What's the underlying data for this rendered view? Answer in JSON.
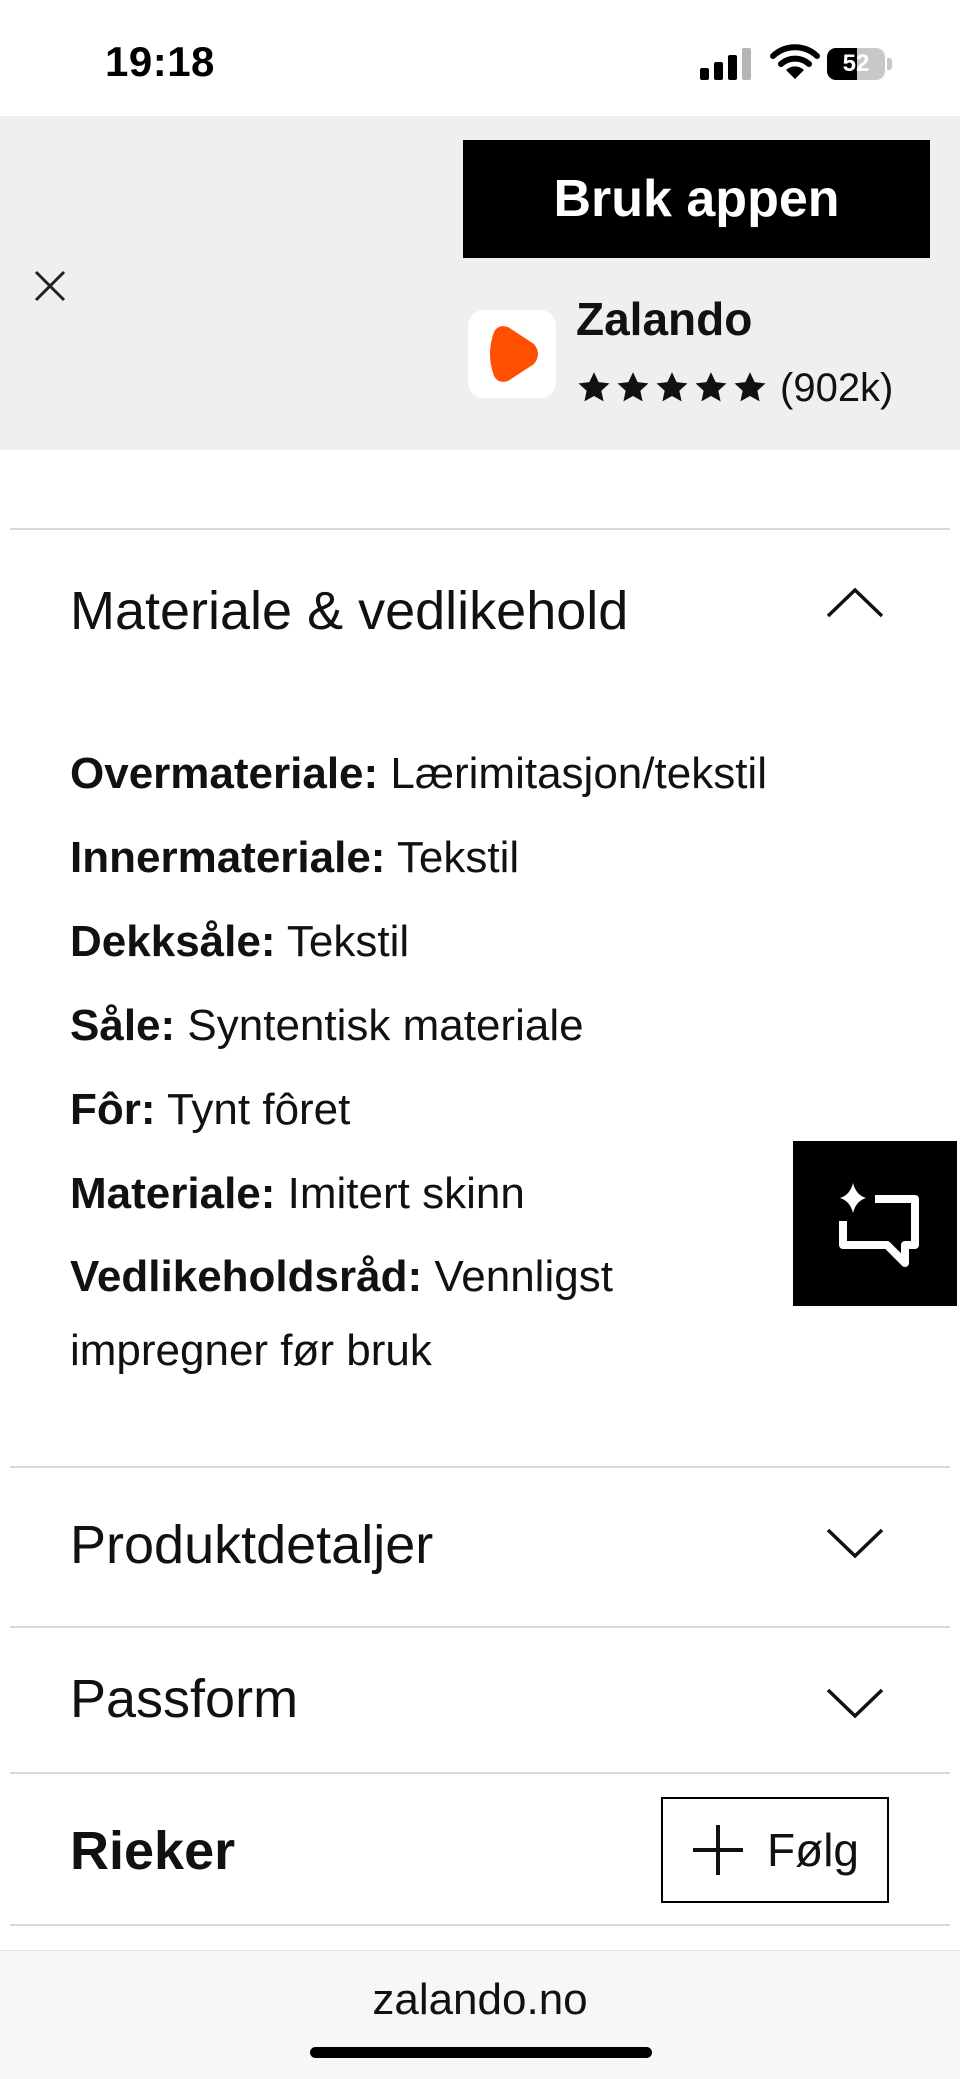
{
  "status_bar": {
    "time": "19:18",
    "battery": "52",
    "battery_level": 0.52
  },
  "banner": {
    "cta_label": "Bruk appen",
    "app_name": "Zalando",
    "rating_stars": 5,
    "rating_count": "(902k)",
    "icon": "zalando-logo",
    "accent_color": "#ff4f00"
  },
  "sections": {
    "material": {
      "title": "Materiale & vedlikehold",
      "expanded": true,
      "items": [
        {
          "label": "Overmateriale:",
          "value": "Lærimitasjon/tekstil"
        },
        {
          "label": "Innermateriale:",
          "value": "Tekstil"
        },
        {
          "label": "Dekksåle:",
          "value": "Tekstil"
        },
        {
          "label": "Såle:",
          "value": "Syntentisk materiale"
        },
        {
          "label": "Fôr:",
          "value": "Tynt fôret"
        },
        {
          "label": "Materiale:",
          "value": "Imitert skinn"
        },
        {
          "label": "Vedlikeholdsråd:",
          "value": "Vennligst impregner før bruk"
        }
      ]
    },
    "product_details": {
      "title": "Produktdetaljer",
      "expanded": false
    },
    "fit": {
      "title": "Passform",
      "expanded": false
    }
  },
  "brand": {
    "name": "Rieker",
    "follow_label": "Følg"
  },
  "url_bar": {
    "url": "zalando.no"
  }
}
